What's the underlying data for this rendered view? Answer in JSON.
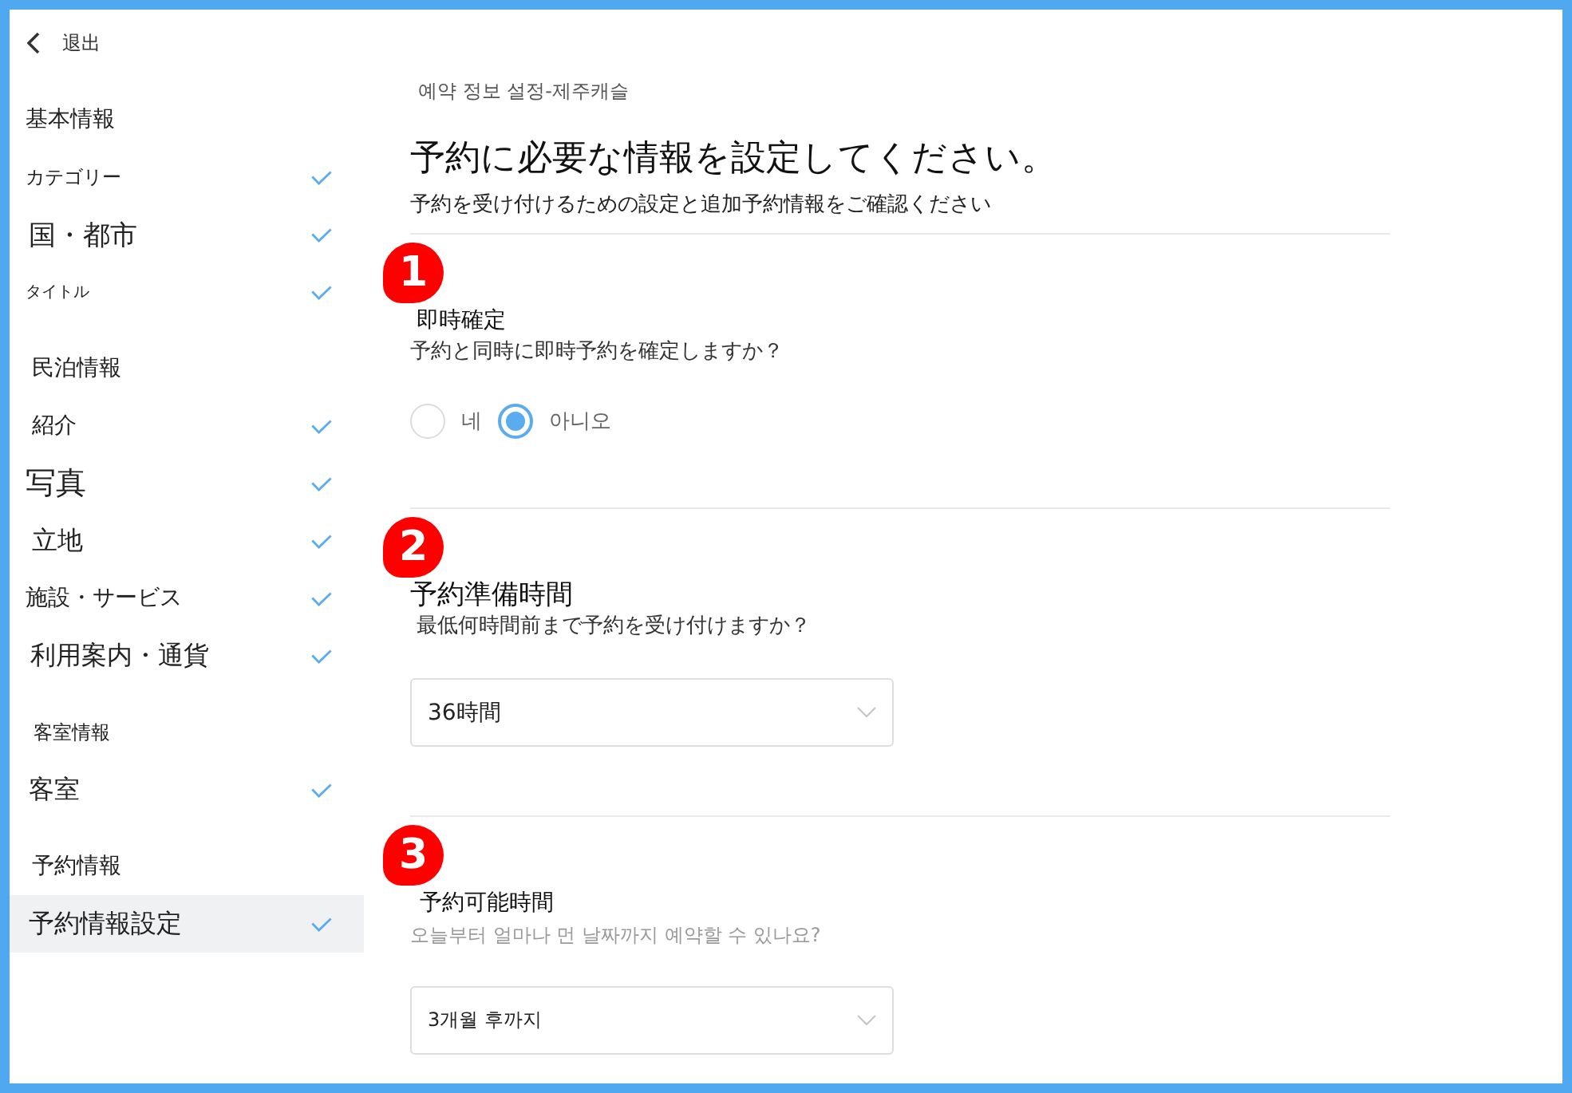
{
  "sidebar": {
    "back_label": "退出",
    "sections": [
      {
        "title": "基本情報",
        "items": [
          {
            "label": "カテゴリー",
            "checked": true,
            "selected": false
          },
          {
            "label": "国・都市",
            "checked": true,
            "selected": false
          },
          {
            "label": "タイトル",
            "checked": true,
            "selected": false
          }
        ]
      },
      {
        "title": "民泊情報",
        "items": [
          {
            "label": "紹介",
            "checked": true,
            "selected": false
          },
          {
            "label": "写真",
            "checked": true,
            "selected": false
          },
          {
            "label": "立地",
            "checked": true,
            "selected": false
          },
          {
            "label": "施設・サービス",
            "checked": true,
            "selected": false
          },
          {
            "label": "利用案内・通貨",
            "checked": true,
            "selected": false
          }
        ]
      },
      {
        "title": "客室情報",
        "items": [
          {
            "label": "客室",
            "checked": true,
            "selected": false
          }
        ]
      },
      {
        "title": "予約情報",
        "items": [
          {
            "label": "予約情報設定",
            "checked": true,
            "selected": true
          }
        ]
      }
    ]
  },
  "main": {
    "breadcrumb": "예약 정보 설정-제주캐슬",
    "title": "予約に必要な情報を設定してください。",
    "subtitle": "予約を受け付けるための設定と追加予約情報をご確認ください",
    "steps": [
      {
        "number": "1",
        "title": "即時確定",
        "question": "予約と同時に即時予約を確定しますか？",
        "kind": "radio",
        "options": [
          {
            "label": "네",
            "selected": false
          },
          {
            "label": "아니오",
            "selected": true
          }
        ]
      },
      {
        "number": "2",
        "title": "予約準備時間",
        "question": "最低何時間前まで予約を受け付けますか？",
        "kind": "select",
        "value": "36時間"
      },
      {
        "number": "3",
        "title": "予約可能時間",
        "question": "오늘부터 얼마나 먼 날짜까지 예약할 수 있나요?",
        "kind": "select",
        "value": "3개월 후까지"
      }
    ]
  }
}
